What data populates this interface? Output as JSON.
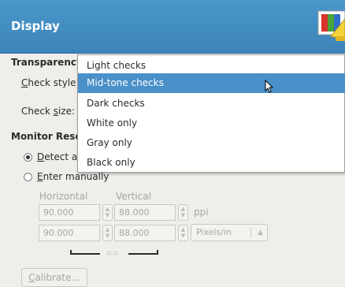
{
  "header": {
    "title": "Display",
    "icon": "display-settings-icon"
  },
  "transparency": {
    "section_label": "Transparency",
    "check_style_label": "Check style:",
    "check_size_label": "Check size:"
  },
  "check_style_menu": {
    "items": [
      "Light checks",
      "Mid-tone checks",
      "Dark checks",
      "White only",
      "Gray only",
      "Black only"
    ],
    "selected": "Mid-tone checks"
  },
  "monitor": {
    "section_label": "Monitor Reso",
    "detect_label": "Detect au",
    "enter_label": "Enter manually",
    "horizontal_label": "Horizontal",
    "vertical_label": "Vertical",
    "row1": {
      "horizontal": "90.000",
      "vertical": "88.000",
      "unit": "ppi"
    },
    "row2": {
      "horizontal": "90.000",
      "vertical": "88.000",
      "unit": "Pixels/in"
    },
    "calibrate_label": "Calibrate..."
  },
  "colors": {
    "header": "#3b84b9",
    "selection": "#4a90c9",
    "background": "#efeeea"
  }
}
